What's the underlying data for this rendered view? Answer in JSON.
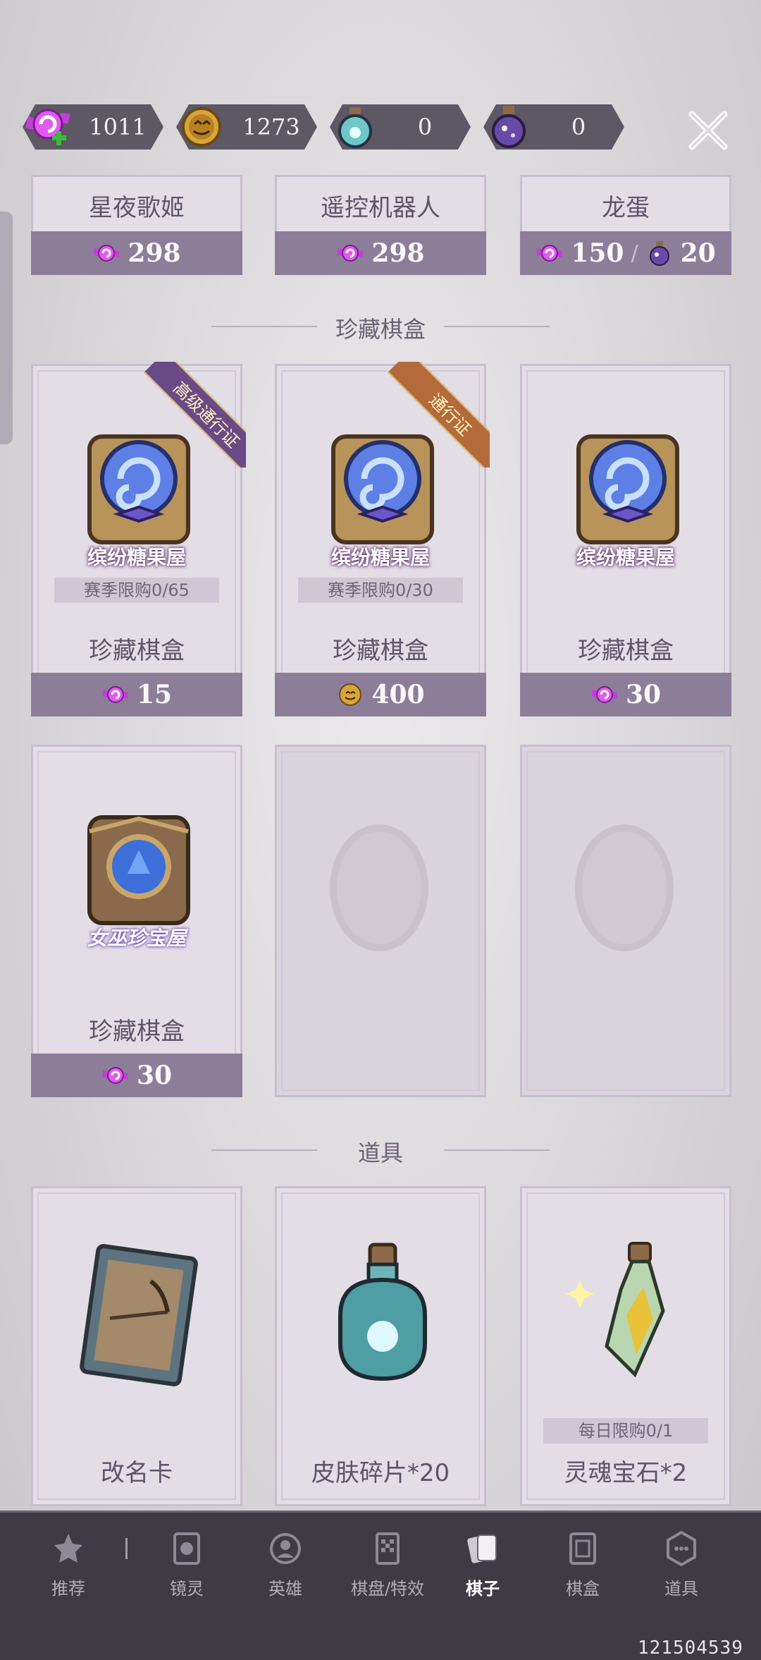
{
  "currencies": [
    {
      "icon": "candy-plus-icon",
      "value": "1011"
    },
    {
      "icon": "pumpkin-coin-icon",
      "value": "1273"
    },
    {
      "icon": "skin-fragment-bottle-icon",
      "value": "0"
    },
    {
      "icon": "purple-potion-icon",
      "value": "0"
    }
  ],
  "top_row": [
    {
      "name": "星夜歌姬",
      "price": "298"
    },
    {
      "name": "遥控机器人",
      "price": "298"
    },
    {
      "name": "龙蛋",
      "price": "150",
      "price_sep": "/",
      "price2": "20"
    }
  ],
  "sections": {
    "boxes": "珍藏棋盒",
    "items": "道具"
  },
  "boxes": [
    {
      "name": "珍藏棋盒",
      "logo": "缤纷糖果屋",
      "limit": "赛季限购0/65",
      "ribbon": "高级通行证",
      "price": "15",
      "currency": "candy"
    },
    {
      "name": "珍藏棋盒",
      "logo": "缤纷糖果屋",
      "limit": "赛季限购0/30",
      "ribbon": "通行证",
      "price": "400",
      "currency": "pumpkin"
    },
    {
      "name": "珍藏棋盒",
      "logo": "缤纷糖果屋",
      "price": "30",
      "currency": "candy"
    },
    {
      "name": "珍藏棋盒",
      "logo": "女巫珍宝屋",
      "price": "30",
      "currency": "candy"
    }
  ],
  "items": [
    {
      "name": "改名卡"
    },
    {
      "name": "皮肤碎片*20"
    },
    {
      "name": "灵魂宝石*2",
      "limit": "每日限购0/1"
    }
  ],
  "nav": [
    {
      "label": "推荐",
      "icon": "recommend-icon"
    },
    {
      "label": "镜灵",
      "icon": "mirror-spirit-icon"
    },
    {
      "label": "英雄",
      "icon": "hero-icon"
    },
    {
      "label": "棋盘/特效",
      "icon": "board-effects-icon"
    },
    {
      "label": "棋子",
      "icon": "chess-piece-icon",
      "active": true
    },
    {
      "label": "棋盒",
      "icon": "chess-box-icon"
    },
    {
      "label": "道具",
      "icon": "items-icon"
    }
  ],
  "uid": "121504539",
  "colors": {
    "price_bar": "#8c7e99",
    "nav_bg": "#3f3a43",
    "card_bg": "#e3dde6"
  }
}
